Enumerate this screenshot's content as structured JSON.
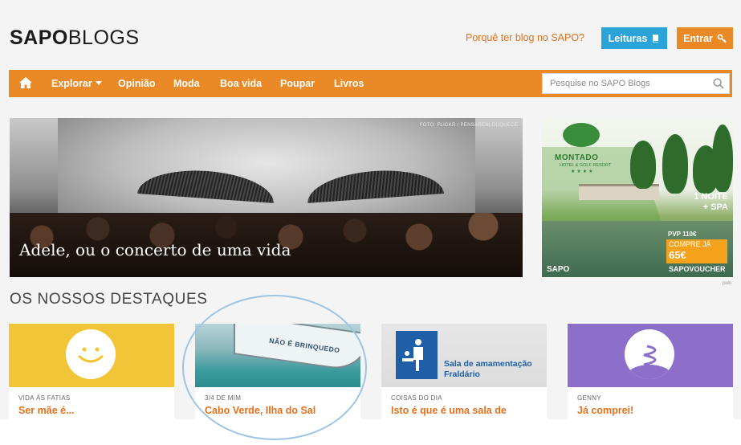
{
  "header": {
    "logo_bold": "SAPO",
    "logo_light": "BLOGS",
    "why_link": "Porquê ter blog no SAPO?",
    "leituras_label": "Leituras",
    "entrar_label": "Entrar"
  },
  "nav": {
    "items": [
      "Explorar",
      "Opinião",
      "Moda",
      "Boa vida",
      "Poupar",
      "Livros"
    ],
    "search_placeholder": "Pesquise no SAPO Blogs"
  },
  "hero": {
    "credit": "FOTO: FLICKR / PENSARENLOUQUECE",
    "title": "Adele, ou o concerto de uma vida"
  },
  "ad": {
    "brand": "MONTADO",
    "brand_sub": "HOTEL & GOLF RESORT",
    "stars": "★★★★",
    "offer_line1": "1 NOITE",
    "offer_line2": "+ SPA",
    "pvp": "PVP 110€",
    "compre": "COMPRE JÁ",
    "price": "65€",
    "sapo": "SAPO",
    "voucher": "SAPOVOUCHER",
    "pub": "pub"
  },
  "destaques": {
    "title": "OS NOSSOS DESTAQUES",
    "cards": [
      {
        "category": "VIDA ÀS FATIAS",
        "title": "Ser mãe é..."
      },
      {
        "category": "3/4 DE MIM",
        "title": "Cabo Verde, Ilha do Sal",
        "image_text": "NÃO É BRINQUEDO"
      },
      {
        "category": "COISAS DO DIA",
        "title": "Isto é que é uma sala de",
        "image_text_1": "Sala de amamentação",
        "image_text_2": "Fraldário"
      },
      {
        "category": "GENNY",
        "title": "Já comprei!"
      }
    ]
  },
  "colors": {
    "orange": "#ea8a27",
    "link_orange": "#e2711d",
    "blue_button": "#2aa3d8",
    "yellow_card": "#f2c437",
    "purple_card": "#8c6fcb",
    "highlight_ellipse": "#9ec4e4"
  },
  "icons": [
    "home-icon",
    "book-icon",
    "key-icon",
    "search-icon",
    "smiley-icon",
    "spring-icon"
  ]
}
